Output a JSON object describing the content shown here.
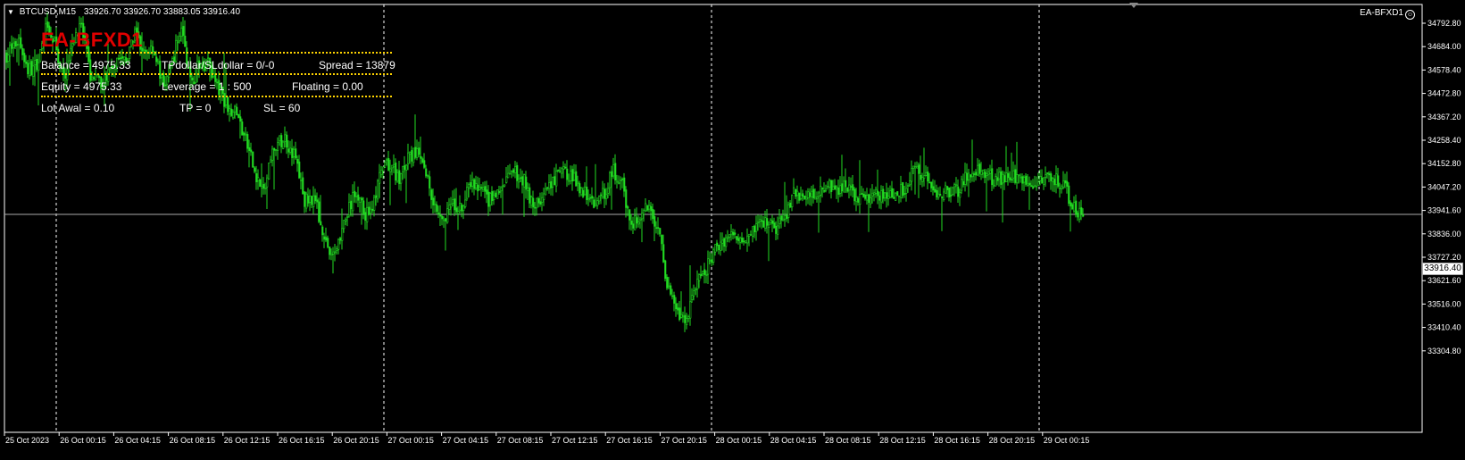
{
  "header": {
    "symbol_timeframe": "BTCUSD,M15",
    "ohlc": "33926.70 33926.70 33883.05 33916.40"
  },
  "ea_label": "EA-BFXD1",
  "panel": {
    "title": "EA-BFXD1",
    "balance": "Balance = 4975.33",
    "tp_sl_dollar": "TPdollar/SLdollar = 0/-0",
    "spread": "Spread  = 13879",
    "equity": "Equity = 4975.33",
    "leverage": "Leverage = 1 : 500",
    "floating": "Floating = 0.00",
    "lot_awal": "Lot Awal  = 0.10",
    "tp": "TP = 0",
    "sl": "SL = 60"
  },
  "current_price": "33916.40",
  "colors": {
    "background": "#000000",
    "candle": "#22dd22",
    "title_red": "#e00000",
    "dotted_line": "#ffd400",
    "axis": "#ffffff",
    "grid": "#ffffff"
  },
  "chart_data": {
    "type": "candlestick",
    "y_tick_labels": [
      "34792.80",
      "34684.00",
      "34578.40",
      "34472.80",
      "34367.20",
      "34258.40",
      "34152.80",
      "34047.20",
      "33941.60",
      "33836.00",
      "33727.20",
      "33621.60",
      "33516.00",
      "33410.40",
      "33304.80"
    ],
    "x_tick_labels": [
      "25 Oct 2023",
      "26 Oct 00:15",
      "26 Oct 04:15",
      "26 Oct 08:15",
      "26 Oct 12:15",
      "26 Oct 16:15",
      "26 Oct 20:15",
      "27 Oct 00:15",
      "27 Oct 04:15",
      "27 Oct 08:15",
      "27 Oct 12:15",
      "27 Oct 16:15",
      "27 Oct 20:15",
      "28 Oct 00:15",
      "28 Oct 04:15",
      "28 Oct 08:15",
      "28 Oct 12:15",
      "28 Oct 16:15",
      "28 Oct 20:15",
      "29 Oct 00:15"
    ],
    "ylim": [
      33280,
      34820
    ],
    "path": [
      [
        0,
        34650
      ],
      [
        14,
        34720
      ],
      [
        24,
        34580
      ],
      [
        34,
        34600
      ],
      [
        44,
        34760
      ],
      [
        54,
        34700
      ],
      [
        64,
        34540
      ],
      [
        74,
        34720
      ],
      [
        84,
        34770
      ],
      [
        94,
        34560
      ],
      [
        104,
        34520
      ],
      [
        114,
        34560
      ],
      [
        124,
        34650
      ],
      [
        134,
        34610
      ],
      [
        144,
        34740
      ],
      [
        154,
        34650
      ],
      [
        164,
        34690
      ],
      [
        176,
        34500
      ],
      [
        186,
        34620
      ],
      [
        196,
        34780
      ],
      [
        206,
        34520
      ],
      [
        216,
        34600
      ],
      [
        226,
        34620
      ],
      [
        236,
        34500
      ],
      [
        248,
        34420
      ],
      [
        258,
        34380
      ],
      [
        268,
        34260
      ],
      [
        278,
        34120
      ],
      [
        288,
        34020
      ],
      [
        300,
        34230
      ],
      [
        312,
        34270
      ],
      [
        324,
        34180
      ],
      [
        334,
        33980
      ],
      [
        344,
        34010
      ],
      [
        354,
        33860
      ],
      [
        364,
        33720
      ],
      [
        372,
        33810
      ],
      [
        382,
        33930
      ],
      [
        392,
        34030
      ],
      [
        402,
        33920
      ],
      [
        412,
        33980
      ],
      [
        420,
        34120
      ],
      [
        430,
        34150
      ],
      [
        440,
        34080
      ],
      [
        450,
        34180
      ],
      [
        460,
        34200
      ],
      [
        470,
        34120
      ],
      [
        480,
        33960
      ],
      [
        490,
        33920
      ],
      [
        500,
        33960
      ],
      [
        510,
        33950
      ],
      [
        520,
        34060
      ],
      [
        530,
        34040
      ],
      [
        540,
        33990
      ],
      [
        550,
        34010
      ],
      [
        560,
        34080
      ],
      [
        570,
        34110
      ],
      [
        580,
        34080
      ],
      [
        590,
        33960
      ],
      [
        600,
        34000
      ],
      [
        610,
        34050
      ],
      [
        620,
        34120
      ],
      [
        630,
        34110
      ],
      [
        640,
        34060
      ],
      [
        650,
        34020
      ],
      [
        660,
        33970
      ],
      [
        670,
        34030
      ],
      [
        680,
        34120
      ],
      [
        690,
        34050
      ],
      [
        700,
        33880
      ],
      [
        710,
        33910
      ],
      [
        720,
        33960
      ],
      [
        730,
        33860
      ],
      [
        740,
        33620
      ],
      [
        750,
        33470
      ],
      [
        760,
        33420
      ],
      [
        770,
        33580
      ],
      [
        780,
        33640
      ],
      [
        790,
        33730
      ],
      [
        800,
        33800
      ],
      [
        810,
        33830
      ],
      [
        820,
        33820
      ],
      [
        830,
        33840
      ],
      [
        840,
        33880
      ],
      [
        850,
        33890
      ],
      [
        860,
        33870
      ],
      [
        870,
        33880
      ],
      [
        880,
        34010
      ],
      [
        890,
        34020
      ],
      [
        900,
        34010
      ],
      [
        910,
        34040
      ],
      [
        920,
        34060
      ],
      [
        930,
        34050
      ],
      [
        940,
        34040
      ],
      [
        950,
        34020
      ],
      [
        960,
        34000
      ],
      [
        970,
        34010
      ],
      [
        980,
        34020
      ],
      [
        990,
        34010
      ],
      [
        1000,
        34030
      ],
      [
        1010,
        34060
      ],
      [
        1016,
        34130
      ],
      [
        1024,
        34100
      ],
      [
        1034,
        34080
      ],
      [
        1044,
        34010
      ],
      [
        1054,
        34040
      ],
      [
        1064,
        34030
      ],
      [
        1074,
        34080
      ],
      [
        1084,
        34130
      ],
      [
        1094,
        34100
      ],
      [
        1104,
        34090
      ],
      [
        1114,
        34080
      ],
      [
        1124,
        34080
      ],
      [
        1134,
        34100
      ],
      [
        1144,
        34080
      ],
      [
        1154,
        34070
      ],
      [
        1164,
        34110
      ],
      [
        1174,
        34090
      ],
      [
        1184,
        34050
      ],
      [
        1194,
        33980
      ],
      [
        1200,
        33940
      ],
      [
        1206,
        33916
      ]
    ]
  }
}
